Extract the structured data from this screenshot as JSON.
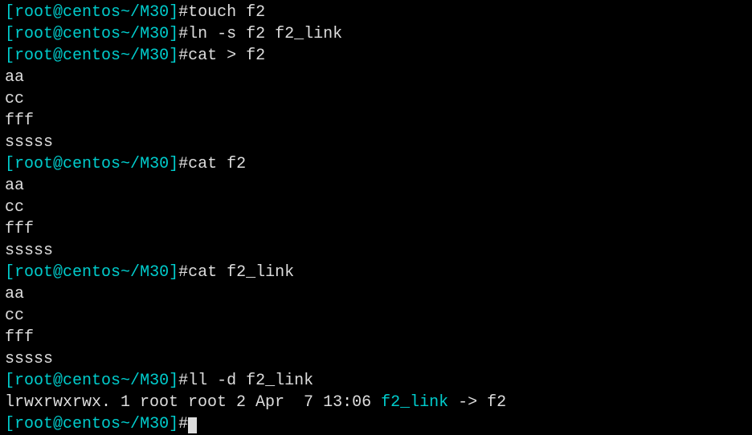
{
  "prompt": {
    "open_bracket": "[",
    "user_host": "root@centos",
    "sep": "~/",
    "dir": "M30",
    "close_bracket": "]",
    "hash": "#"
  },
  "commands": {
    "cmd1": "touch f2",
    "cmd2": "ln -s f2 f2_link",
    "cmd3": "cat > f2",
    "cmd4": "cat f2",
    "cmd5": "cat f2_link",
    "cmd6": "ll -d f2_link"
  },
  "output": {
    "line1": "aa",
    "line2": "cc",
    "line3": "fff",
    "line4": "sssss"
  },
  "ll_output": {
    "perms": "lrwxrwxrwx. 1 root root 2 Apr  7 13:06 ",
    "link_name": "f2_link",
    "arrow": " -> ",
    "target": "f2"
  }
}
